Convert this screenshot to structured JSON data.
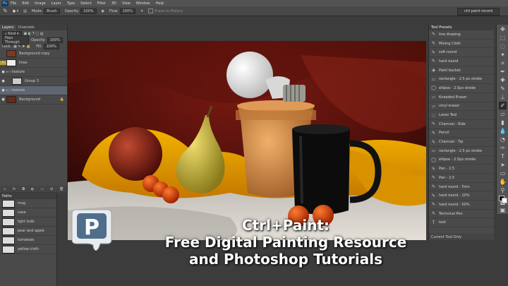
{
  "app": {
    "logo_label": "Ps",
    "document_tab": "ctrl paint record"
  },
  "menu": [
    "File",
    "Edit",
    "Image",
    "Layer",
    "Type",
    "Select",
    "Filter",
    "3D",
    "View",
    "Window",
    "Help"
  ],
  "options": {
    "mode_label": "Mode:",
    "mode_value": "Brush",
    "opacity_label": "Opacity:",
    "opacity_value": "100%",
    "flow_label": "Flow:",
    "flow_value": "100%",
    "history_label": "Erase to History"
  },
  "layers_panel": {
    "tabs": [
      "Layers",
      "Channels"
    ],
    "kind_filter": "Kind",
    "blend_mode": "Pass Through",
    "opacity_label": "Opacity:",
    "opacity_value": "100%",
    "lock_label": "Lock:",
    "fill_label": "Fill:",
    "fill_value": "100%",
    "layers": [
      {
        "name": "Background copy",
        "indent": 0
      },
      {
        "name": "lines",
        "indent": 0
      },
      {
        "name": "texture",
        "indent": 0
      },
      {
        "name": "Group 3",
        "indent": 1
      },
      {
        "name": "texture",
        "indent": 0
      },
      {
        "name": "Background",
        "indent": 0
      }
    ]
  },
  "paths_panel": {
    "title": "Paths",
    "items": [
      "mug",
      "vase",
      "light bulb",
      "pear and apple",
      "tomatoes",
      "yellow cloth"
    ]
  },
  "presets_panel": {
    "title": "Tool Presets",
    "items": [
      "line drawing",
      "Mixing Cloth",
      "soft round",
      "hard round",
      "Paint bucket",
      "rectangle - 2.5 px stroke",
      "ellipse - 2.5px stroke",
      "Kneaded Eraser",
      "vinyl eraser",
      "Lasso Tool",
      "Charcoal - Side",
      "Pencil",
      "Charcoal - Tip",
      "rectangle - 2.5 px stroke",
      "ellipse - 2.5px stroke",
      "Pen - 2.5",
      "Pen - 2.5",
      "hard round - 5mn",
      "hard round - 10%",
      "hard round - 50%",
      "Technical Pen",
      "text"
    ],
    "footer": "Current Tool Only"
  },
  "overlay": {
    "line1": "Ctrl+Paint:",
    "line2": "Free Digital Painting Resource",
    "line3": "and Photoshop Tutorials",
    "logo_letter": "P"
  }
}
